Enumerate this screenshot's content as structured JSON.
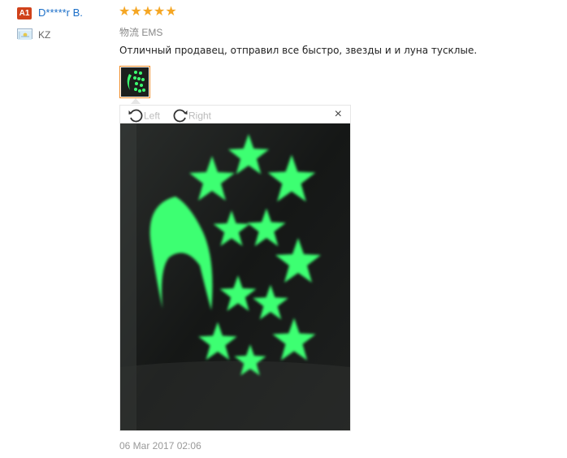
{
  "reviewer": {
    "badge": "A1",
    "name": "D*****r B.",
    "country": "KZ",
    "flag_icon": "kazakhstan-flag-icon"
  },
  "review": {
    "rating": 5,
    "stars_display": "★★★★★",
    "logistics": "物流 EMS",
    "text": "Отличный продавец, отправил все быстро, звезды и и луна тусклые.",
    "date": "06 Mar 2017 02:06"
  },
  "viewer": {
    "rotate_left_label": "Left",
    "rotate_right_label": "Right",
    "close_glyph": "×"
  },
  "colors": {
    "username": "#1a6ec8",
    "stars": "#f5a623",
    "thumb_border": "#f08a24",
    "glow": "#3cff70",
    "badge": "#d0421b"
  }
}
